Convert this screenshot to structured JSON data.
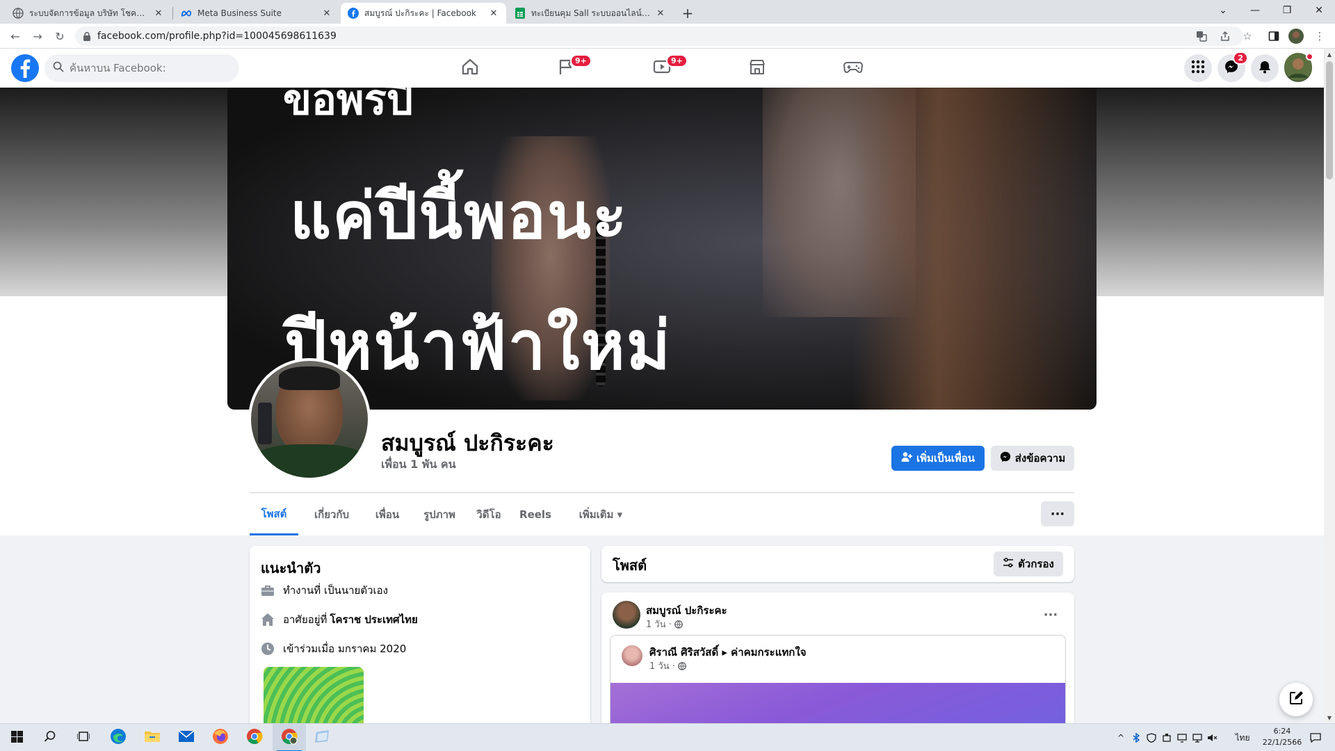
{
  "browser": {
    "tabs": [
      {
        "label": "ระบบจัดการข้อมูล บริษัท โชคลูกโชค ...",
        "active": false
      },
      {
        "label": "Meta Business Suite",
        "active": false
      },
      {
        "label": "สมบูรณ์ ปะกิระคะ | Facebook",
        "active": true
      },
      {
        "label": "ทะเบียนคุม Sall ระบบออนไลน์.xlsx - G...",
        "active": false
      }
    ],
    "url": "facebook.com/profile.php?id=100045698611639"
  },
  "fb": {
    "search_placeholder": "ค้นหาบน Facebook:",
    "badges": {
      "pages": "9+",
      "watch": "9+",
      "messenger": "2"
    }
  },
  "cover": {
    "top_text": "ขอพรปี",
    "line1": "แค่ปีนี้พอนะ",
    "line2": "ปีหน้าฟ้าใหม่"
  },
  "profile": {
    "name": "สมบูรณ์ ปะกิระคะ",
    "friends": "เพื่อน 1 พัน คน",
    "add_friend_label": "เพิ่มเป็นเพื่อน",
    "message_label": "ส่งข้อความ",
    "more_label": "···"
  },
  "profile_tabs": [
    {
      "label": "โพสต์",
      "active": true
    },
    {
      "label": "เกี่ยวกับ",
      "active": false
    },
    {
      "label": "เพื่อน",
      "active": false
    },
    {
      "label": "รูปภาพ",
      "active": false
    },
    {
      "label": "วิดีโอ",
      "active": false
    },
    {
      "label": "Reels",
      "active": false
    },
    {
      "label": "เพิ่มเติม ▾",
      "active": false
    }
  ],
  "intro": {
    "title": "แนะนำตัว",
    "work": "ทำงานที่ เป็นนายตัวเอง",
    "lives_prefix": "อาศัยอยู่ที่",
    "lives_place": "โคราช ประเทศไทย",
    "joined": "เข้าร่วมเมื่อ มกราคม 2020"
  },
  "posts_header": {
    "title": "โพสต์",
    "filter_label": "ตัวกรอง"
  },
  "post": {
    "author": "สมบูรณ์ ปะกิระคะ",
    "time": "1 วัน ·",
    "shared_author": "ศิราณี ศิริสวัสดิ์ ▸ ค่าคมกระแทกใจ",
    "shared_time": "1 วัน ·"
  },
  "taskbar": {
    "lang": "ไทย",
    "time": "6:24",
    "date": "22/1/2566"
  },
  "colors": {
    "fb_blue": "#1877f2",
    "button_blue": "#1b74e4",
    "badge_red": "#e41e3f"
  }
}
